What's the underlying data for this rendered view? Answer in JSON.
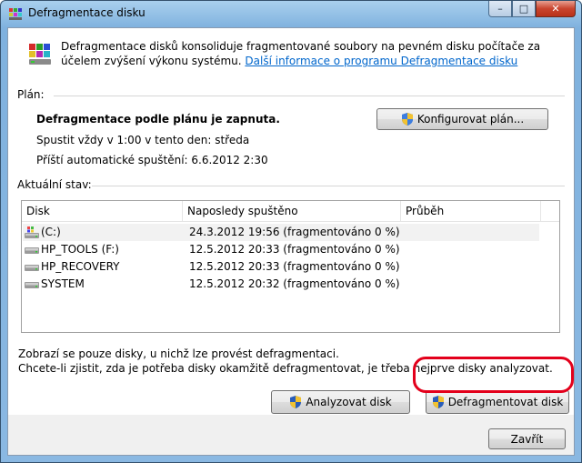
{
  "window": {
    "title": "Defragmentace disku",
    "minimize": "–",
    "maximize": "□",
    "close": "✕"
  },
  "intro": {
    "text": "Defragmentace disků konsoliduje fragmentované soubory na pevném disku počítače za účelem zvýšení výkonu systému. ",
    "link": "Další informace o programu Defragmentace disku"
  },
  "plan": {
    "label": "Plán:",
    "status": "Defragmentace podle plánu je zapnuta.",
    "run": "Spustit vždy v 1:00 v tento den: středa",
    "next": "Příští automatické spuštění: 6.6.2012 2:30",
    "configure_button": "Konfigurovat plán..."
  },
  "current": {
    "label": "Aktuální stav:",
    "columns": [
      "Disk",
      "Naposledy spuštěno",
      "Průběh"
    ],
    "rows": [
      {
        "disk": "(C:)",
        "last": "24.3.2012 19:56 (fragmentováno 0 %)",
        "progress": "",
        "icon": "system-drive-icon"
      },
      {
        "disk": "HP_TOOLS (F:)",
        "last": "12.5.2012 20:33 (fragmentováno 0 %)",
        "progress": "",
        "icon": "drive-icon"
      },
      {
        "disk": "HP_RECOVERY",
        "last": "12.5.2012 20:33 (fragmentováno 0 %)",
        "progress": "",
        "icon": "drive-icon"
      },
      {
        "disk": "SYSTEM",
        "last": "12.5.2012 20:32 (fragmentováno 0 %)",
        "progress": "",
        "icon": "drive-icon"
      }
    ]
  },
  "notes": {
    "line1": "Zobrazí se pouze disky, u nichž lze provést defragmentaci.",
    "line2": "Chcete-li zjistit, zda je potřeba disky okamžitě defragmentovat, je třeba nejprve disky analyzovat."
  },
  "buttons": {
    "analyze": "Analyzovat disk",
    "defrag": "Defragmentovat disk",
    "close": "Zavřít"
  },
  "colors": {
    "highlight": "#e3001b",
    "link": "#0066cc"
  }
}
